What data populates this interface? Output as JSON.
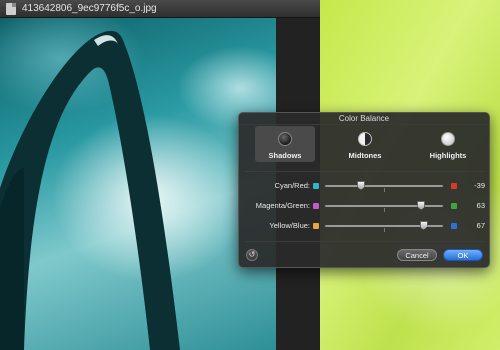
{
  "window": {
    "title": "413642806_9ec9776f5c_o.jpg"
  },
  "dialog": {
    "title": "Color Balance",
    "modes": [
      {
        "label": "Shadows",
        "icon": "shadows-icon",
        "selected": true
      },
      {
        "label": "Midtones",
        "icon": "midtones-icon",
        "selected": false
      },
      {
        "label": "Highlights",
        "icon": "highlights-icon",
        "selected": false
      }
    ],
    "sliders": [
      {
        "label": "Cyan/Red:",
        "value": "-39",
        "level": -39,
        "left_color": "#2bb8c8",
        "right_color": "#d83a2a"
      },
      {
        "label": "Magenta/Green:",
        "value": "63",
        "level": 63,
        "left_color": "#c25bc8",
        "right_color": "#3aa83a"
      },
      {
        "label": "Yellow/Blue:",
        "value": "67",
        "level": 67,
        "left_color": "#e9a63a",
        "right_color": "#2f6fd8"
      }
    ],
    "buttons": {
      "cancel": "Cancel",
      "ok": "OK",
      "reset_icon": "reset-icon"
    }
  },
  "colors": {
    "accent": "#3a7ee0",
    "background_right": "#c8ec50"
  }
}
